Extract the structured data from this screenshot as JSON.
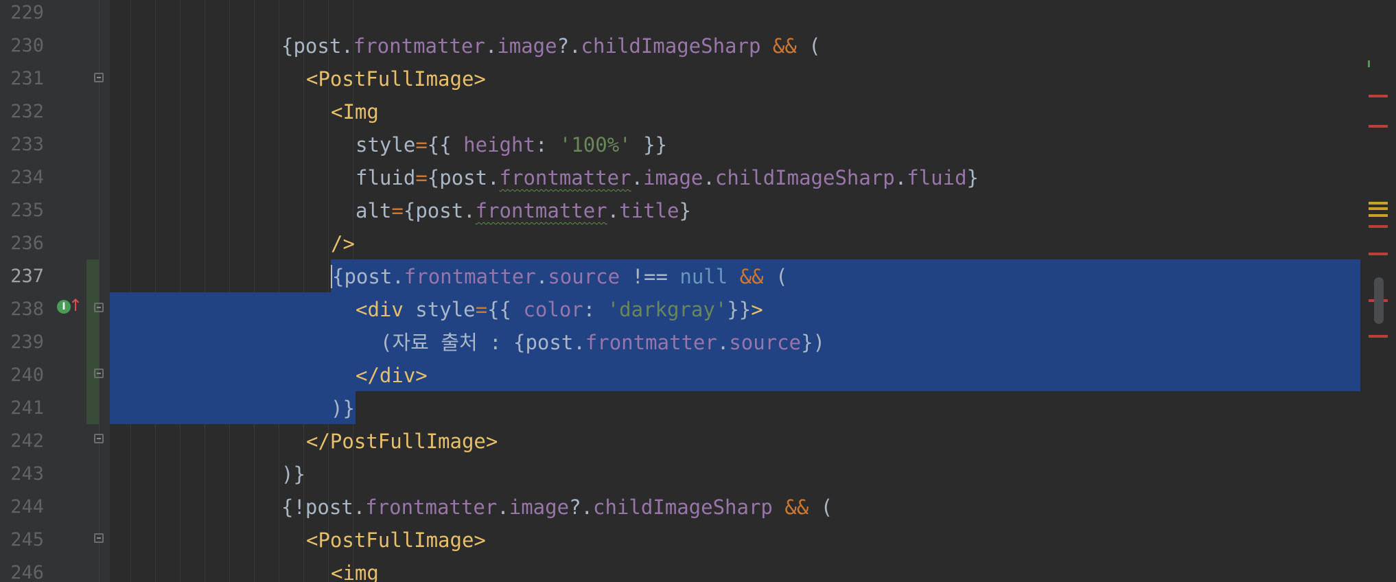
{
  "editor": {
    "current_line": "237",
    "lines": [
      {
        "n": "229",
        "code": []
      },
      {
        "n": "230",
        "code": [
          [
            "t",
            "{post."
          ],
          [
            "p",
            "frontmatter"
          ],
          [
            "t",
            "."
          ],
          [
            "p",
            "image"
          ],
          [
            "t",
            "?."
          ],
          [
            "p",
            "childImageSharp"
          ],
          [
            "t",
            " "
          ],
          [
            "k",
            "&&"
          ],
          [
            "t",
            " ("
          ]
        ]
      },
      {
        "n": "231",
        "code": [
          [
            "g",
            "<PostFullImage>"
          ]
        ]
      },
      {
        "n": "232",
        "code": [
          [
            "g",
            "<Img"
          ]
        ]
      },
      {
        "n": "233",
        "code": [
          [
            "t",
            "style"
          ],
          [
            "k",
            "="
          ],
          [
            "t",
            "{{ "
          ],
          [
            "p",
            "height"
          ],
          [
            "t",
            ": "
          ],
          [
            "s",
            "'100%'"
          ],
          [
            "t",
            " }}"
          ]
        ]
      },
      {
        "n": "234",
        "code": [
          [
            "t",
            "fluid"
          ],
          [
            "k",
            "="
          ],
          [
            "t",
            "{post."
          ],
          [
            "pw",
            "frontmatter"
          ],
          [
            "t",
            "."
          ],
          [
            "p",
            "image"
          ],
          [
            "t",
            "."
          ],
          [
            "p",
            "childImageSharp"
          ],
          [
            "t",
            "."
          ],
          [
            "p",
            "fluid"
          ],
          [
            "t",
            "}"
          ]
        ]
      },
      {
        "n": "235",
        "code": [
          [
            "t",
            "alt"
          ],
          [
            "k",
            "="
          ],
          [
            "t",
            "{post."
          ],
          [
            "pw",
            "frontmatter"
          ],
          [
            "t",
            "."
          ],
          [
            "p",
            "title"
          ],
          [
            "t",
            "}"
          ]
        ]
      },
      {
        "n": "236",
        "code": [
          [
            "g",
            "/>"
          ]
        ]
      },
      {
        "n": "237",
        "code": [
          [
            "c",
            "{"
          ],
          [
            "t",
            "post."
          ],
          [
            "p",
            "frontmatter"
          ],
          [
            "t",
            "."
          ],
          [
            "p",
            "source"
          ],
          [
            "t",
            " !== "
          ],
          [
            "n",
            "null"
          ],
          [
            "t",
            " "
          ],
          [
            "k",
            "&&"
          ],
          [
            "t",
            " ("
          ]
        ]
      },
      {
        "n": "238",
        "code": [
          [
            "g",
            "<div"
          ],
          [
            "t",
            " style"
          ],
          [
            "k",
            "="
          ],
          [
            "t",
            "{{ "
          ],
          [
            "p",
            "color"
          ],
          [
            "t",
            ": "
          ],
          [
            "s",
            "'darkgray'"
          ],
          [
            "t",
            "}}"
          ],
          [
            "g",
            ">"
          ]
        ]
      },
      {
        "n": "239",
        "code": [
          [
            "t",
            "(자료 출처 : {post."
          ],
          [
            "p",
            "frontmatter"
          ],
          [
            "t",
            "."
          ],
          [
            "p",
            "source"
          ],
          [
            "t",
            "})"
          ]
        ]
      },
      {
        "n": "240",
        "code": [
          [
            "g",
            "</div>"
          ]
        ]
      },
      {
        "n": "241",
        "code": [
          [
            "t",
            ")}"
          ]
        ]
      },
      {
        "n": "242",
        "code": [
          [
            "g",
            "</PostFullImage>"
          ]
        ]
      },
      {
        "n": "243",
        "code": [
          [
            "t",
            ")}"
          ]
        ]
      },
      {
        "n": "244",
        "code": [
          [
            "t",
            "{!post."
          ],
          [
            "p",
            "frontmatter"
          ],
          [
            "t",
            "."
          ],
          [
            "p",
            "image"
          ],
          [
            "t",
            "?."
          ],
          [
            "p",
            "childImageSharp"
          ],
          [
            "t",
            " "
          ],
          [
            "k",
            "&&"
          ],
          [
            "t",
            " ("
          ]
        ]
      },
      {
        "n": "245",
        "code": [
          [
            "g",
            "<PostFullImage>"
          ]
        ]
      },
      {
        "n": "246",
        "code": [
          [
            "g",
            "<img"
          ]
        ]
      }
    ]
  },
  "gutter_icons": {
    "implemented_icon": "I",
    "implemented_arrow": "↑"
  },
  "colors": {
    "background": "#2b2b2b",
    "selection": "#214283",
    "tag": "#e8bf6a",
    "property": "#9876aa",
    "string": "#6a8759",
    "keyword": "#cc7832",
    "text": "#a9b7c6"
  }
}
